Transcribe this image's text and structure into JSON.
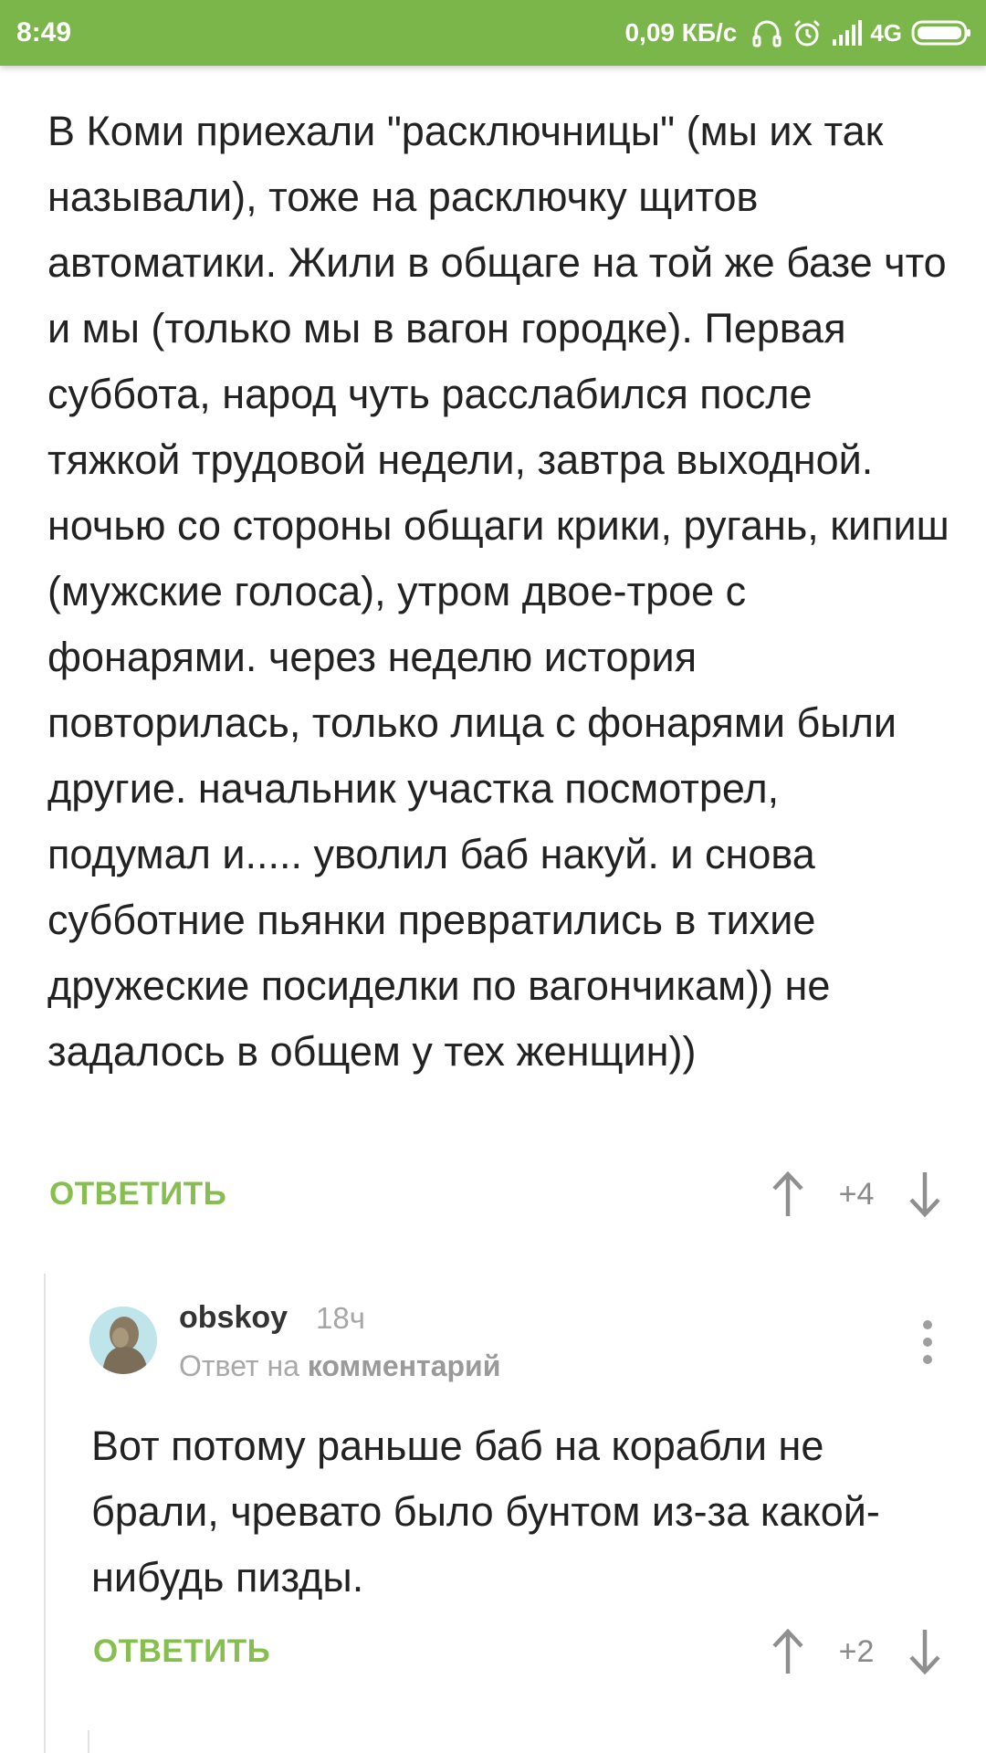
{
  "status_bar": {
    "time": "8:49",
    "speed": "0,09 КБ/с",
    "network": "4G",
    "icons": [
      "headphones-icon",
      "alarm-icon",
      "signal-icon",
      "battery-icon"
    ]
  },
  "colors": {
    "status_bar_bg": "#7bb64a",
    "accent_green": "#86bf50",
    "text": "#222222",
    "muted": "#8a8a8a"
  },
  "comment": {
    "text": "В Коми приехали \"расключницы\" (мы их так называли), тоже на расключку щитов автоматики. Жили в общаге на той же базе что и мы (только мы в вагон городке). Первая суббота, народ чуть расслабился после тяжкой трудовой недели, завтра выходной. ночью со стороны общаги крики, ругань, кипиш (мужские голоса), утром двое-трое с фонарями. через неделю история повторилась, только лица с фонарями были другие. начальник участка посмотрел, подумал и..... уволил баб накуй. и снова субботние пьянки превратились в тихие дружеские посиделки по вагончикам)) не задалось в общем у тех женщин))",
    "reply_label": "ОТВЕТИТЬ",
    "rating": "+4"
  },
  "reply": {
    "username": "obskoy",
    "time_ago": "18ч",
    "reply_to_prefix": "Ответ на",
    "reply_to_link": "комментарий",
    "text": "Вот потому раньше баб на корабли не брали, чревато было бунтом из-за какой-нибудь пизды.",
    "reply_label": "ОТВЕТИТЬ",
    "rating": "+2"
  }
}
